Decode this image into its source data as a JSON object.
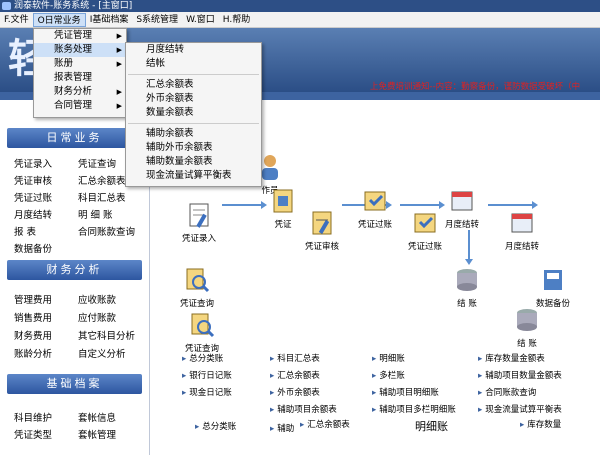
{
  "window": {
    "title": "润泰软件-账务系统 - [主窗口]"
  },
  "menubar": [
    "F.文件",
    "O日常业务",
    "I基础档案",
    "S系统管理",
    "W.窗口",
    "H.帮助"
  ],
  "menu1": [
    {
      "label": "凭证管理",
      "has_sub": true
    },
    {
      "label": "账务处理",
      "has_sub": true
    },
    {
      "label": "账册",
      "has_sub": true
    },
    {
      "label": "报表管理",
      "has_sub": false
    },
    {
      "label": "财务分析",
      "has_sub": true
    },
    {
      "label": "合同管理",
      "has_sub": true
    }
  ],
  "menu2_top": [
    "月度结转",
    "结帐"
  ],
  "menu2_mid": [
    "汇总余额表",
    "外币余额表",
    "数量余额表"
  ],
  "menu2_bot": [
    "辅助余额表",
    "辅助外币余额表",
    "辅助数量余额表",
    "现金流量试算平衡表"
  ],
  "notice": "上免费培训通知--内容：勤察备份，谨防数据受破坏（中",
  "left": {
    "section1": "日常业务",
    "items1": [
      [
        "凭证录入",
        "凭证查询"
      ],
      [
        "凭证审核",
        "汇总余额表"
      ],
      [
        "凭证过账",
        "科目汇总表"
      ],
      [
        "月度结转",
        "明 细 账"
      ],
      [
        "报    表",
        "合同账款查询"
      ],
      [
        "数据备份",
        ""
      ]
    ],
    "section2": "财务分析",
    "items2": [
      [
        "管理费用",
        "应收账款"
      ],
      [
        "销售费用",
        "应付账款"
      ],
      [
        "财务费用",
        "其它科目分析"
      ],
      [
        "账龄分析",
        "自定义分析"
      ]
    ],
    "section3": "基础档案",
    "items3": [
      [
        "科目维护",
        "套帐信息"
      ],
      [
        "凭证类型",
        "套帐管理"
      ]
    ]
  },
  "flow": {
    "entry": "凭证录入",
    "submit": "凭证审核",
    "audit": "凭证审核",
    "post": "凭证过账",
    "month": "月度结转",
    "month2": "月度结转",
    "close1": "结 账",
    "backup": "数据备份",
    "query1": "凭证查询",
    "query2": "凭证查询",
    "close2": "结 账",
    "sub1": "凭证",
    "sub2": "作员"
  },
  "reports": [
    [
      "总分类账",
      "科目汇总表",
      "明细账",
      "库存数量金额表"
    ],
    [
      "银行日记账",
      "汇总余额表",
      "多栏账",
      "辅助项目数量金额表"
    ],
    [
      "现金日记账",
      "外币余额表",
      "辅助项目明细账",
      "合同账款查询"
    ],
    [
      "",
      "辅助项目余额表",
      "辅助项目多栏明细账",
      "现金流量试算平衡表"
    ]
  ],
  "bottom": {
    "a": "总分类账",
    "b": "辅助",
    "c": "汇总余额表",
    "d": "明细账",
    "e": "库存数量"
  },
  "colors": {
    "accent": "#3d63a0",
    "notice": "#dd2222"
  }
}
